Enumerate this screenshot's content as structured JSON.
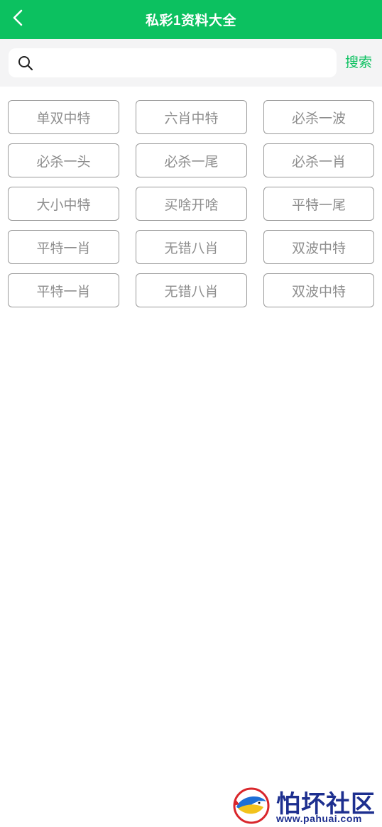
{
  "header": {
    "title": "私彩1资料大全",
    "back_icon": "chevron-left-icon",
    "background": "#0cc160"
  },
  "search": {
    "icon": "search-icon",
    "value": "",
    "placeholder": "",
    "button_label": "搜索",
    "accent": "#0cc160"
  },
  "grid": {
    "items": [
      "单双中特",
      "六肖中特",
      "必杀一波",
      "必杀一头",
      "必杀一尾",
      "必杀一肖",
      "大小中特",
      "买啥开啥",
      "平特一尾",
      "平特一肖",
      "无错八肖",
      "双波中特",
      "平特一肖",
      "无错八肖",
      "双波中特"
    ]
  },
  "watermark": {
    "name": "怕坏社区",
    "url": "www.pahuai.com"
  }
}
